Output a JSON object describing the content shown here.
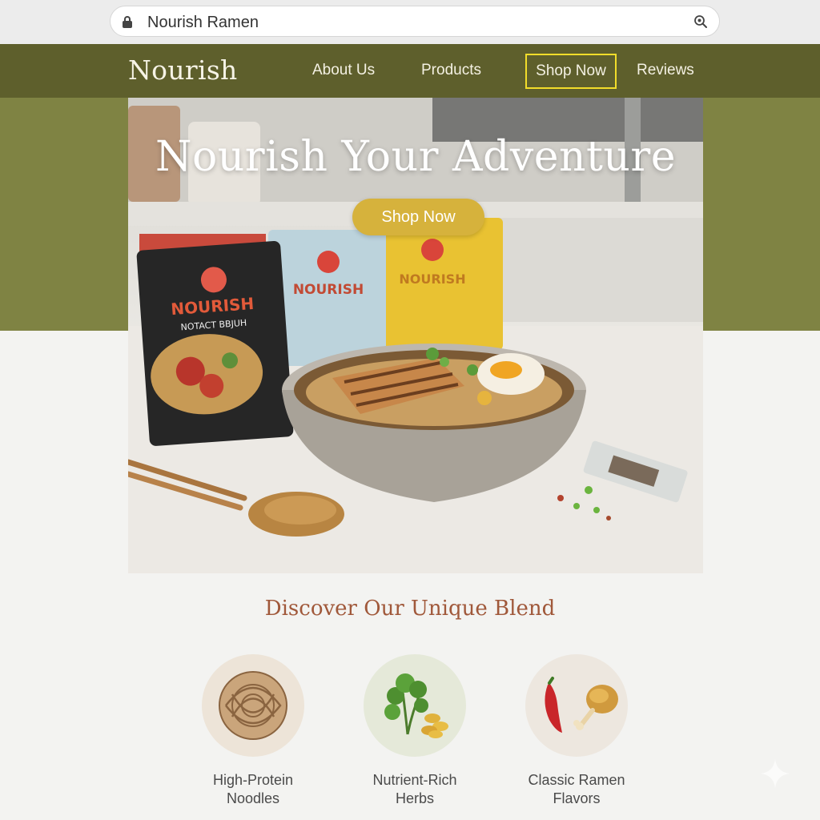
{
  "browser": {
    "url": "Nourish Ramen",
    "lock_icon": "lock-icon",
    "zoom_icon": "zoom-icon"
  },
  "nav": {
    "logo": "Nourish",
    "links": [
      "About Us",
      "Products",
      "Shop Now",
      "Reviews"
    ]
  },
  "hero": {
    "title": "Nourish Your Adventure",
    "cta": "Shop Now",
    "image": "ramen-bowl-with-packages-photo"
  },
  "discover": {
    "heading": "Discover Our Unique Blend",
    "features": [
      {
        "label": "High-Protein Noodles",
        "icon": "noodles-icon"
      },
      {
        "label": "Nutrient-Rich Herbs",
        "icon": "herbs-icon"
      },
      {
        "label": "Classic Ramen Flavors",
        "icon": "chicken-pepper-icon"
      }
    ]
  },
  "colors": {
    "nav_bg": "#5e5f2c",
    "band_bg": "#7f8343",
    "accent_gold": "#d6b23c",
    "highlight_border": "#f2dd2a",
    "heading_rust": "#a0583a"
  }
}
